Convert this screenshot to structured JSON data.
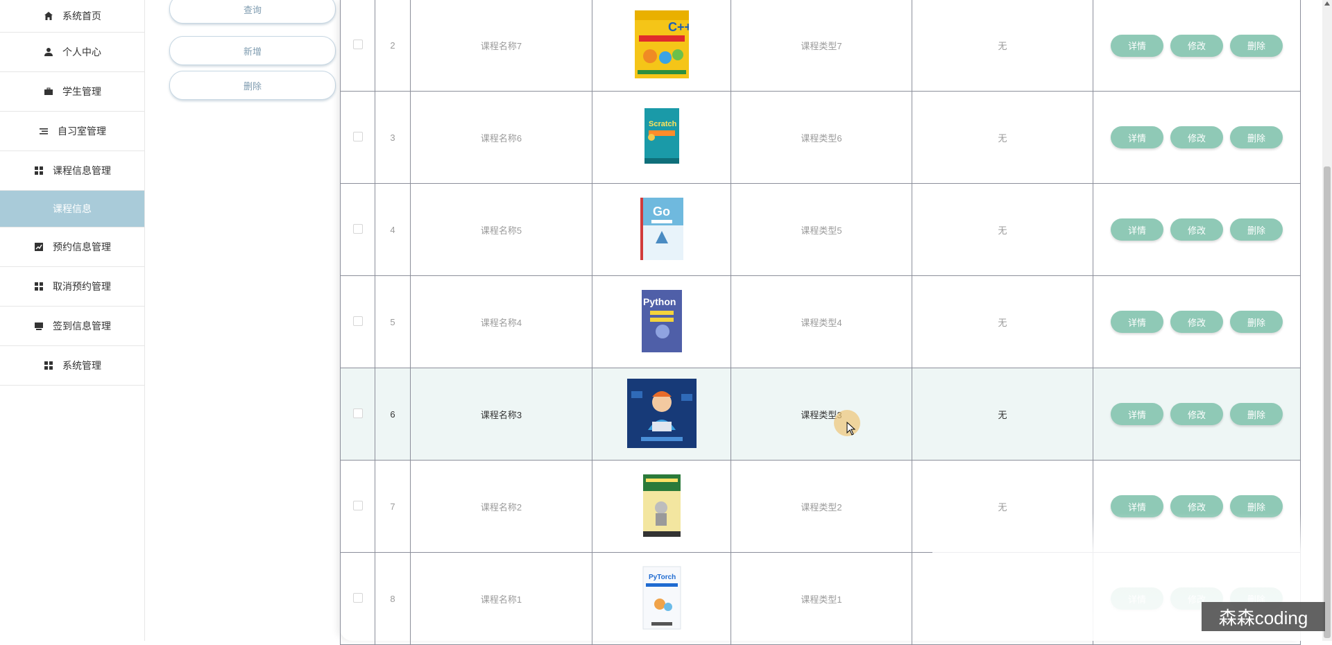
{
  "sidebar": {
    "items": [
      {
        "label": "系统首页",
        "icon": "home-icon"
      },
      {
        "label": "个人中心",
        "icon": "user-icon"
      },
      {
        "label": "学生管理",
        "icon": "briefcase-icon"
      },
      {
        "label": "自习室管理",
        "icon": "list-icon"
      },
      {
        "label": "课程信息管理",
        "icon": "grid-icon"
      },
      {
        "label": "课程信息",
        "icon": ""
      },
      {
        "label": "预约信息管理",
        "icon": "chart-icon"
      },
      {
        "label": "取消预约管理",
        "icon": "grid-icon"
      },
      {
        "label": "签到信息管理",
        "icon": "inbox-icon"
      },
      {
        "label": "系统管理",
        "icon": "grid-icon"
      }
    ]
  },
  "actions": {
    "query": "查询",
    "add": "新增",
    "delete": "删除"
  },
  "row_buttons": {
    "detail": "详情",
    "edit": "修改",
    "delete": "删除"
  },
  "rows": [
    {
      "index": "2",
      "name": "课程名称7",
      "type": "课程类型7",
      "note": "无",
      "cover": "C++ book cover"
    },
    {
      "index": "3",
      "name": "课程名称6",
      "type": "课程类型6",
      "note": "无",
      "cover": "Scratch book cover"
    },
    {
      "index": "4",
      "name": "课程名称5",
      "type": "课程类型5",
      "note": "无",
      "cover": "Go book cover"
    },
    {
      "index": "5",
      "name": "课程名称4",
      "type": "课程类型4",
      "note": "无",
      "cover": "Python book cover"
    },
    {
      "index": "6",
      "name": "课程名称3",
      "type": "课程类型3",
      "note": "无",
      "cover": "Programmer illustration"
    },
    {
      "index": "7",
      "name": "课程名称2",
      "type": "课程类型2",
      "note": "无",
      "cover": "Python robot book cover"
    },
    {
      "index": "8",
      "name": "课程名称1",
      "type": "课程类型1",
      "note": "",
      "cover": "PyTorch book cover"
    }
  ],
  "book_text": {
    "cpp": "C++",
    "scratch": "Scratch",
    "go": "Go",
    "python": "Python",
    "pytorch": "PyTorch"
  },
  "watermark": "森森coding",
  "colors": {
    "active_menu": "#a9cbd9",
    "row_button": "#8fc9b6",
    "highlight_row": "#eef6f5"
  }
}
